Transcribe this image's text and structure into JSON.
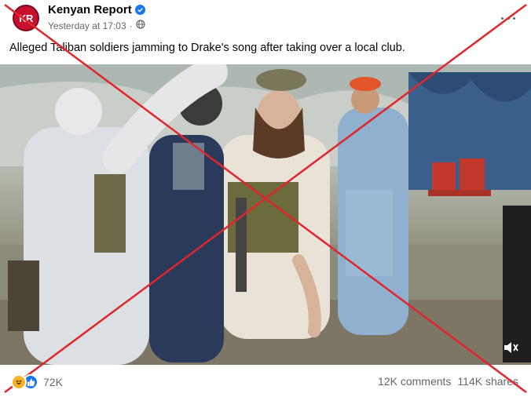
{
  "post": {
    "page_name": "Kenyan Report",
    "avatar_text": "KR",
    "timestamp": "Yesterday at 17:03",
    "caption": "Alleged Taliban soldiers jamming to Drake's song after taking over a local club.",
    "reaction_count": "72K",
    "comments": "12K comments",
    "shares": "114K shares"
  },
  "icons": {
    "verified": "verified-badge-icon",
    "privacy": "globe-icon",
    "more": "more-options-icon",
    "volume": "volume-icon",
    "reaction_haha": "haha-reaction-icon",
    "reaction_like": "like-reaction-icon"
  },
  "colors": {
    "brand_blue": "#1877f2",
    "overlay_red": "#e0262a",
    "text_secondary": "#65676b"
  }
}
